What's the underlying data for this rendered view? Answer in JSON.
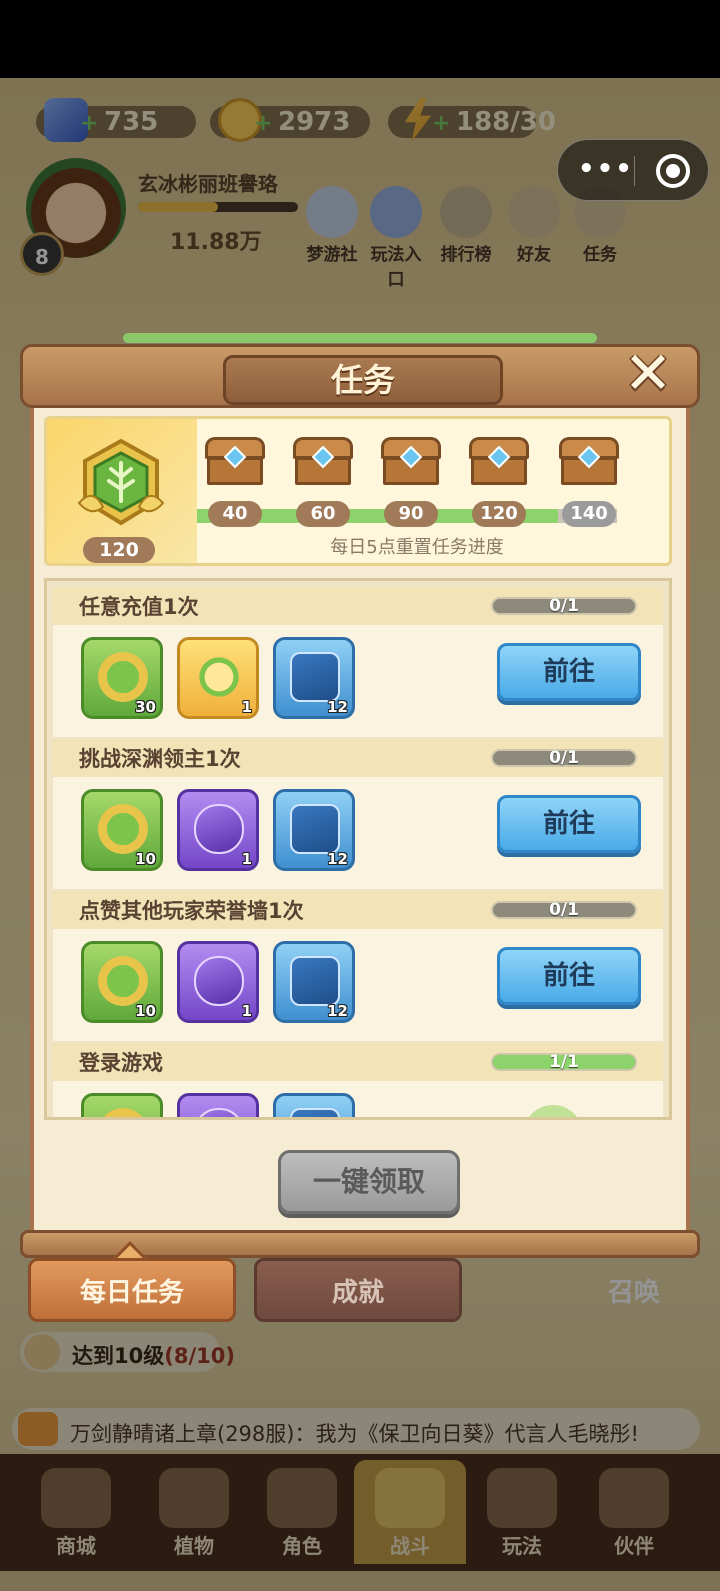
{
  "hud": {
    "diamonds": "735",
    "coins": "2973",
    "energy": "188/30",
    "player_name": "玄冰彬丽班譽珞",
    "level": "8",
    "power": "11.88万",
    "top_icons": [
      "梦游社",
      "玩法入口",
      "排行榜",
      "好友",
      "任务"
    ]
  },
  "modal": {
    "title": "任务",
    "points": "120",
    "milestones": [
      "40",
      "60",
      "90",
      "120",
      "140"
    ],
    "progress_fraction": 0.86,
    "reset_note": "每日5点重置任务进度",
    "tasks": [
      {
        "name": "任意充值1次",
        "progress": "0/1",
        "progress_value": 0,
        "rewards": [
          {
            "type": "green",
            "icon": "leaf-badge-icon",
            "qty": "30"
          },
          {
            "type": "gold",
            "icon": "golden-fruit-icon",
            "qty": "1"
          },
          {
            "type": "blue",
            "icon": "blue-book-icon",
            "qty": "12"
          }
        ],
        "action": "前往"
      },
      {
        "name": "挑战深渊领主1次",
        "progress": "0/1",
        "progress_value": 0,
        "rewards": [
          {
            "type": "green",
            "icon": "leaf-badge-icon",
            "qty": "10"
          },
          {
            "type": "purple",
            "icon": "purple-capsule-icon",
            "qty": "1"
          },
          {
            "type": "blue",
            "icon": "blue-book-icon",
            "qty": "12"
          }
        ],
        "action": "前往"
      },
      {
        "name": "点赞其他玩家荣誉墙1次",
        "progress": "0/1",
        "progress_value": 0,
        "rewards": [
          {
            "type": "green",
            "icon": "leaf-badge-icon",
            "qty": "10"
          },
          {
            "type": "purple",
            "icon": "purple-capsule-icon",
            "qty": "1"
          },
          {
            "type": "blue",
            "icon": "blue-book-icon",
            "qty": "12"
          }
        ],
        "action": "前往"
      },
      {
        "name": "登录游戏",
        "progress": "1/1",
        "progress_value": 1,
        "rewards": [
          {
            "type": "green",
            "icon": "leaf-badge-icon",
            "qty": ""
          },
          {
            "type": "purple",
            "icon": "purple-capsule-icon",
            "qty": ""
          },
          {
            "type": "blue",
            "icon": "blue-book-icon",
            "qty": ""
          }
        ],
        "action": ""
      }
    ],
    "claim_all": "一键领取"
  },
  "tabs": {
    "daily": "每日任务",
    "achievement": "成就"
  },
  "background": {
    "goal_label": "达到10级",
    "goal_progress": "(8/10)",
    "chat": "万剑静晴诸上章(298服)：我为《保卫向日葵》代言人毛晓彤!",
    "summon": "召唤",
    "nav": [
      "商城",
      "植物",
      "角色",
      "战斗",
      "玩法",
      "伙伴"
    ]
  }
}
